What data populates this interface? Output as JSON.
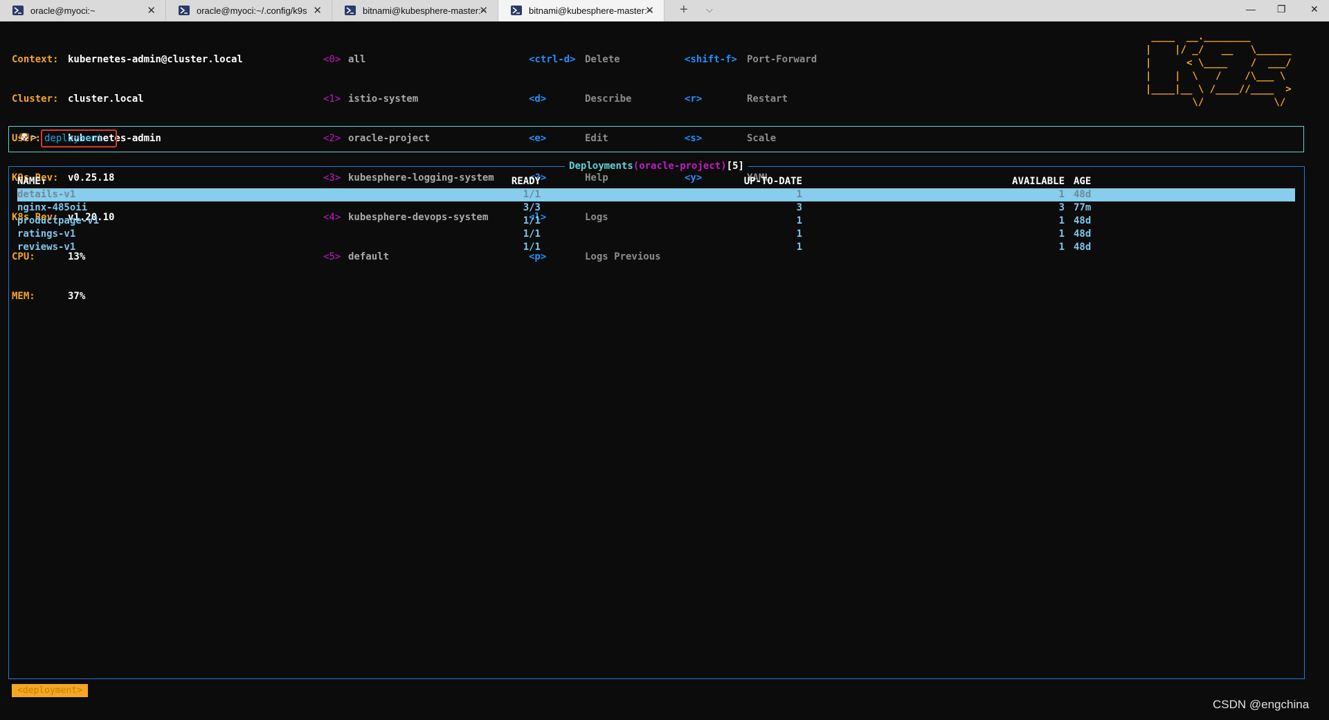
{
  "tabs": [
    {
      "title": "oracle@myoci:~",
      "close": "✕"
    },
    {
      "title": "oracle@myoci:~/.config/k9s",
      "close": "✕"
    },
    {
      "title": "bitnami@kubesphere-master:~",
      "close": "✕"
    },
    {
      "title": "bitnami@kubesphere-master:~",
      "close": "✕"
    }
  ],
  "tabbar": {
    "new": "+",
    "dropdown": "⌵",
    "minimize": "—",
    "restore": "❐",
    "close": "✕"
  },
  "info": [
    {
      "label": "Context:",
      "value": "kubernetes-admin@cluster.local"
    },
    {
      "label": "Cluster:",
      "value": "cluster.local"
    },
    {
      "label": "User:",
      "value": "kubernetes-admin"
    },
    {
      "label": "K9s Rev:",
      "value": "v0.25.18"
    },
    {
      "label": "K8s Rev:",
      "value": "v1.20.10"
    },
    {
      "label": "CPU:",
      "value": "13%"
    },
    {
      "label": "MEM:",
      "value": "37%"
    }
  ],
  "namespaces": [
    {
      "key": "<0>",
      "name": "all"
    },
    {
      "key": "<1>",
      "name": "istio-system"
    },
    {
      "key": "<2>",
      "name": "oracle-project"
    },
    {
      "key": "<3>",
      "name": "kubesphere-logging-system"
    },
    {
      "key": "<4>",
      "name": "kubesphere-devops-system"
    },
    {
      "key": "<5>",
      "name": "default"
    }
  ],
  "hotkeys1": [
    {
      "key": "<ctrl-d>",
      "action": "Delete"
    },
    {
      "key": "<d>",
      "action": "Describe"
    },
    {
      "key": "<e>",
      "action": "Edit"
    },
    {
      "key": "<?>",
      "action": "Help"
    },
    {
      "key": "<l>",
      "action": "Logs"
    },
    {
      "key": "<p>",
      "action": "Logs Previous"
    }
  ],
  "hotkeys2": [
    {
      "key": "<shift-f>",
      "action": "Port-Forward"
    },
    {
      "key": "<r>",
      "action": "Restart"
    },
    {
      "key": "<s>",
      "action": "Scale"
    },
    {
      "key": "<y>",
      "action": "YAML"
    }
  ],
  "logo": " ____  __.________\n|    |/ _/   __   \\______\n|      < \\____    /  ___/\n|    |  \\   /    /\\___ \\\n|____|__ \\ /____//____  >\n        \\/            \\/",
  "prompt": {
    "caret": ">",
    "value": "deployment"
  },
  "table": {
    "title_name": "Deployments",
    "open_paren": "(",
    "namespace": "oracle-project",
    "close_paren": ")",
    "count": "[5]",
    "columns": {
      "name": "NAME↑",
      "ready": "READY",
      "up_to_date": "UP-TO-DATE",
      "available": "AVAILABLE",
      "age": "AGE"
    },
    "rows": [
      {
        "name": "details-v1",
        "ready": "1/1",
        "up_to_date": "1",
        "available": "1",
        "age": "48d"
      },
      {
        "name": "nginx-485oii",
        "ready": "3/3",
        "up_to_date": "3",
        "available": "3",
        "age": "77m"
      },
      {
        "name": "productpage-v1",
        "ready": "1/1",
        "up_to_date": "1",
        "available": "1",
        "age": "48d"
      },
      {
        "name": "ratings-v1",
        "ready": "1/1",
        "up_to_date": "1",
        "available": "1",
        "age": "48d"
      },
      {
        "name": "reviews-v1",
        "ready": "1/1",
        "up_to_date": "1",
        "available": "1",
        "age": "48d"
      }
    ]
  },
  "crumb": "<deployment>",
  "watermark": "CSDN @engchina"
}
